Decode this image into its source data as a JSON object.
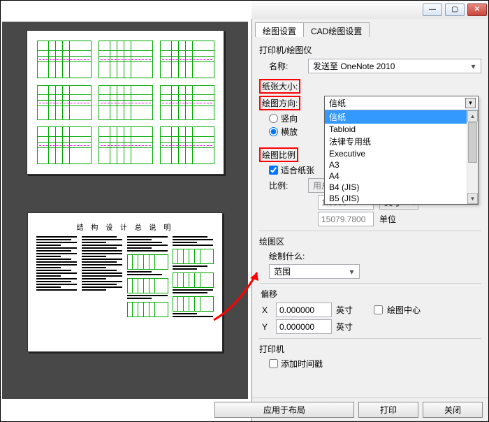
{
  "window": {
    "min": "—",
    "max": "▢",
    "close": "✕"
  },
  "tabs": {
    "plot": "绘图设置",
    "cad": "CAD绘图设置"
  },
  "printer": {
    "group": "打印机/绘图仪",
    "name_label": "名称:",
    "name_value": "发送至 OneNote 2010"
  },
  "paper": {
    "label": "纸张大小:",
    "selected": "信纸",
    "options": [
      "信纸",
      "Tabloid",
      "法律专用纸",
      "Executive",
      "A3",
      "A4",
      "B4 (JIS)",
      "B5 (JIS)"
    ]
  },
  "orientation": {
    "label": "绘图方向:",
    "portrait": "竖向",
    "landscape": "横放"
  },
  "scale": {
    "label": "绘图比例",
    "fit": "适合纸张",
    "ratio_label": "比例:",
    "ratio_value": "用户",
    "val1": "1.0000",
    "unit1": "英寸",
    "eq": "=",
    "val2": "15079.7800",
    "unit2": "单位"
  },
  "area": {
    "group": "绘图区",
    "what_label": "绘制什么:",
    "what_value": "范围"
  },
  "offset": {
    "group": "偏移",
    "x_label": "X",
    "x_value": "0.000000",
    "y_label": "Y",
    "y_value": "0.000000",
    "unit": "英寸",
    "center": "绘图中心"
  },
  "printer2": {
    "group": "打印机",
    "timestamp": "添加时间戳"
  },
  "footer": {
    "apply": "应用于布局",
    "print": "打印",
    "close": "关闭"
  },
  "doc_title": "结 构 设 计 总 说 明"
}
